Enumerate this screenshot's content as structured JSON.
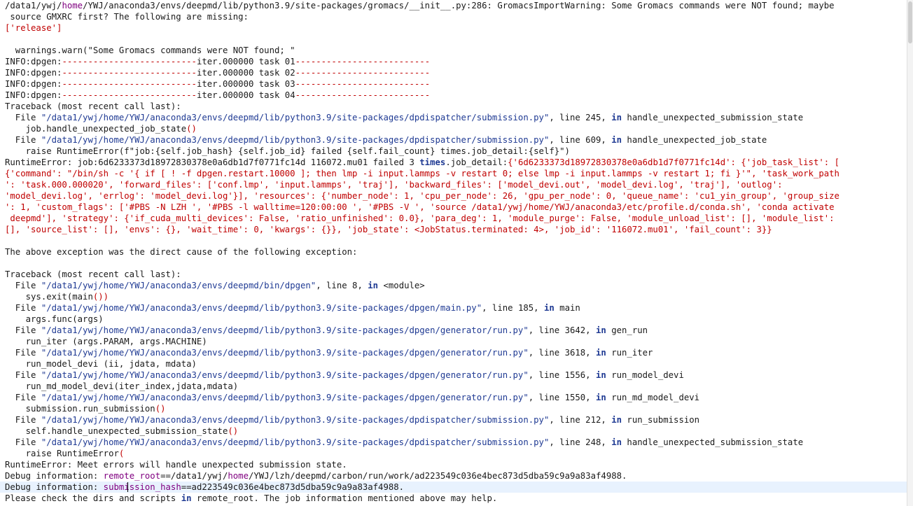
{
  "colors": {
    "text": "#1a1a1a",
    "path_purple": "#800080",
    "string_red": "#c00000",
    "link_blue": "#1f3a93",
    "highlight": "#e8f2fe"
  },
  "console_lines": [
    [
      {
        "t": "/data1/ywj/"
      },
      {
        "t": "home",
        "c": "p"
      },
      {
        "t": "/YWJ/anaconda3/envs/deepmd/lib/python3.9/site-packages/gromacs/__init__.py:286: GromacsImportWarning: Some Gromacs commands were NOT found; maybe"
      }
    ],
    [
      {
        "t": " source GMXRC first? The following are missing:"
      }
    ],
    [
      {
        "t": "['release']",
        "c": "r"
      }
    ],
    [
      {
        "t": ""
      }
    ],
    [
      {
        "t": "  warnings.warn(\"Some Gromacs commands were NOT found; \""
      }
    ],
    [
      {
        "t": "INFO:dpgen:"
      },
      {
        "t": "--------------------------",
        "c": "r"
      },
      {
        "t": "iter.000000 task 01"
      },
      {
        "t": "--------------------------",
        "c": "r"
      }
    ],
    [
      {
        "t": "INFO:dpgen:"
      },
      {
        "t": "--------------------------",
        "c": "r"
      },
      {
        "t": "iter.000000 task 02"
      },
      {
        "t": "--------------------------",
        "c": "r"
      }
    ],
    [
      {
        "t": "INFO:dpgen:"
      },
      {
        "t": "--------------------------",
        "c": "r"
      },
      {
        "t": "iter.000000 task 03"
      },
      {
        "t": "--------------------------",
        "c": "r"
      }
    ],
    [
      {
        "t": "INFO:dpgen:"
      },
      {
        "t": "--------------------------",
        "c": "r"
      },
      {
        "t": "iter.000000 task 04"
      },
      {
        "t": "--------------------------",
        "c": "r"
      }
    ],
    [
      {
        "t": "Traceback (most recent call last):"
      }
    ],
    [
      {
        "t": "  File "
      },
      {
        "t": "\"/data1/ywj/home/YWJ/anaconda3/envs/deepmd/lib/python3.9/site-packages/dpdispatcher/submission.py\"",
        "c": "s"
      },
      {
        "t": ", line 245, "
      },
      {
        "t": "in",
        "c": "k"
      },
      {
        "t": " handle_unexpected_submission_state"
      }
    ],
    [
      {
        "t": "    job.handle_unexpected_job_state"
      },
      {
        "t": "()",
        "c": "r"
      }
    ],
    [
      {
        "t": "  File "
      },
      {
        "t": "\"/data1/ywj/home/YWJ/anaconda3/envs/deepmd/lib/python3.9/site-packages/dpdispatcher/submission.py\"",
        "c": "s"
      },
      {
        "t": ", line 609, "
      },
      {
        "t": "in",
        "c": "k"
      },
      {
        "t": " handle_unexpected_job_state"
      }
    ],
    [
      {
        "t": "    raise RuntimeError(f\"job:{self.job_hash} {self.job_id} failed {self.fail_count} times.job_detail:{self}\")"
      }
    ],
    [
      {
        "t": "RuntimeError: job:6d6233373d18972830378e0a6db1d7f0771fc14d 116072.mu01 failed 3 "
      },
      {
        "t": "times",
        "c": "k"
      },
      {
        "t": ".job_detail:"
      },
      {
        "t": "{'6d6233373d18972830378e0a6db1d7f0771fc14d': {'job_task_list': [",
        "c": "r"
      }
    ],
    [
      {
        "t": "{'command': \"/bin/sh -c '{ if [ ! -f dpgen.restart.10000 ]; then lmp -i input.lammps -v restart 0; else lmp -i input.lammps -v restart 1; fi }'\", 'task_work_path",
        "c": "r"
      }
    ],
    [
      {
        "t": "': 'task.000.000020', 'forward_files': ['conf.lmp', 'input.lammps', 'traj'], 'backward_files': ['model_devi.out', 'model_devi.log', 'traj'], 'outlog':",
        "c": "r"
      }
    ],
    [
      {
        "t": "'model_devi.log', 'errlog': 'model_devi.log'}], 'resources': {'number_node': 1, 'cpu_per_node': 26, 'gpu_per_node': 0, 'queue_name': 'cu1_yin_group', 'group_size",
        "c": "r"
      }
    ],
    [
      {
        "t": "': 1, 'custom_flags': ['#PBS -N LZH ', '#PBS -l walltime=120:00:00 ', '#PBS -V ', 'source /data1/ywj/home/YWJ/anaconda3/etc/profile.d/conda.sh', 'conda activate",
        "c": "r"
      }
    ],
    [
      {
        "t": " deepmd'], 'strategy': {'if_cuda_multi_devices': False, 'ratio_unfinished': 0.0}, 'para_deg': 1, 'module_purge': False, 'module_unload_list': [], 'module_list':",
        "c": "r"
      }
    ],
    [
      {
        "t": "[], 'source_list': [], 'envs': {}, 'wait_time': 0, 'kwargs': {}}, 'job_state': <JobStatus.terminated: 4>, 'job_id': '116072.mu01', 'fail_count': 3}}",
        "c": "r"
      }
    ],
    [
      {
        "t": ""
      }
    ],
    [
      {
        "t": "The above exception was the direct cause of the following exception:"
      }
    ],
    [
      {
        "t": ""
      }
    ],
    [
      {
        "t": "Traceback (most recent call last):"
      }
    ],
    [
      {
        "t": "  File "
      },
      {
        "t": "\"/data1/ywj/home/YWJ/anaconda3/envs/deepmd/bin/dpgen\"",
        "c": "s"
      },
      {
        "t": ", line 8, "
      },
      {
        "t": "in",
        "c": "k"
      },
      {
        "t": " <module>"
      }
    ],
    [
      {
        "t": "    sys.exit(main"
      },
      {
        "t": "())",
        "c": "r"
      }
    ],
    [
      {
        "t": "  File "
      },
      {
        "t": "\"/data1/ywj/home/YWJ/anaconda3/envs/deepmd/lib/python3.9/site-packages/dpgen/main.py\"",
        "c": "s"
      },
      {
        "t": ", line 185, "
      },
      {
        "t": "in",
        "c": "k"
      },
      {
        "t": " main"
      }
    ],
    [
      {
        "t": "    args.func(args)"
      }
    ],
    [
      {
        "t": "  File "
      },
      {
        "t": "\"/data1/ywj/home/YWJ/anaconda3/envs/deepmd/lib/python3.9/site-packages/dpgen/generator/run.py\"",
        "c": "s"
      },
      {
        "t": ", line 3642, "
      },
      {
        "t": "in",
        "c": "k"
      },
      {
        "t": " gen_run"
      }
    ],
    [
      {
        "t": "    run_iter (args.PARAM, args.MACHINE)"
      }
    ],
    [
      {
        "t": "  File "
      },
      {
        "t": "\"/data1/ywj/home/YWJ/anaconda3/envs/deepmd/lib/python3.9/site-packages/dpgen/generator/run.py\"",
        "c": "s"
      },
      {
        "t": ", line 3618, "
      },
      {
        "t": "in",
        "c": "k"
      },
      {
        "t": " run_iter"
      }
    ],
    [
      {
        "t": "    run_model_devi (ii, jdata, mdata)"
      }
    ],
    [
      {
        "t": "  File "
      },
      {
        "t": "\"/data1/ywj/home/YWJ/anaconda3/envs/deepmd/lib/python3.9/site-packages/dpgen/generator/run.py\"",
        "c": "s"
      },
      {
        "t": ", line 1556, "
      },
      {
        "t": "in",
        "c": "k"
      },
      {
        "t": " run_model_devi"
      }
    ],
    [
      {
        "t": "    run_md_model_devi(iter_index,jdata,mdata)"
      }
    ],
    [
      {
        "t": "  File "
      },
      {
        "t": "\"/data1/ywj/home/YWJ/anaconda3/envs/deepmd/lib/python3.9/site-packages/dpgen/generator/run.py\"",
        "c": "s"
      },
      {
        "t": ", line 1550, "
      },
      {
        "t": "in",
        "c": "k"
      },
      {
        "t": " run_md_model_devi"
      }
    ],
    [
      {
        "t": "    submission.run_submission"
      },
      {
        "t": "()",
        "c": "r"
      }
    ],
    [
      {
        "t": "  File "
      },
      {
        "t": "\"/data1/ywj/home/YWJ/anaconda3/envs/deepmd/lib/python3.9/site-packages/dpdispatcher/submission.py\"",
        "c": "s"
      },
      {
        "t": ", line 212, "
      },
      {
        "t": "in",
        "c": "k"
      },
      {
        "t": " run_submission"
      }
    ],
    [
      {
        "t": "    self.handle_unexpected_submission_state"
      },
      {
        "t": "()",
        "c": "r"
      }
    ],
    [
      {
        "t": "  File "
      },
      {
        "t": "\"/data1/ywj/home/YWJ/anaconda3/envs/deepmd/lib/python3.9/site-packages/dpdispatcher/submission.py\"",
        "c": "s"
      },
      {
        "t": ", line 248, "
      },
      {
        "t": "in",
        "c": "k"
      },
      {
        "t": " handle_unexpected_submission_state"
      }
    ],
    [
      {
        "t": "    raise RuntimeError"
      },
      {
        "t": "(",
        "c": "r"
      }
    ],
    [
      {
        "t": "RuntimeError: Meet errors will handle unexpected submission state."
      }
    ],
    [
      {
        "t": "Debug information: "
      },
      {
        "t": "remote_root",
        "c": "p"
      },
      {
        "t": "==/data1/ywj/"
      },
      {
        "t": "home",
        "c": "p"
      },
      {
        "t": "/YWJ/lzh/deepmd/carbon/run/work/ad223549c036e4bec873d5dba59c9a9a83af4988."
      }
    ],
    [
      {
        "t": "Debug information: "
      },
      {
        "t": "submission_hash",
        "c": "p"
      },
      {
        "t": "==ad223549c036e4bec873d5dba59c9a9a83af4988."
      }
    ],
    [
      {
        "t": "Please check the dirs and scripts "
      },
      {
        "t": "in",
        "c": "k"
      },
      {
        "t": " remote_root. The job information mentioned above may help."
      }
    ]
  ]
}
